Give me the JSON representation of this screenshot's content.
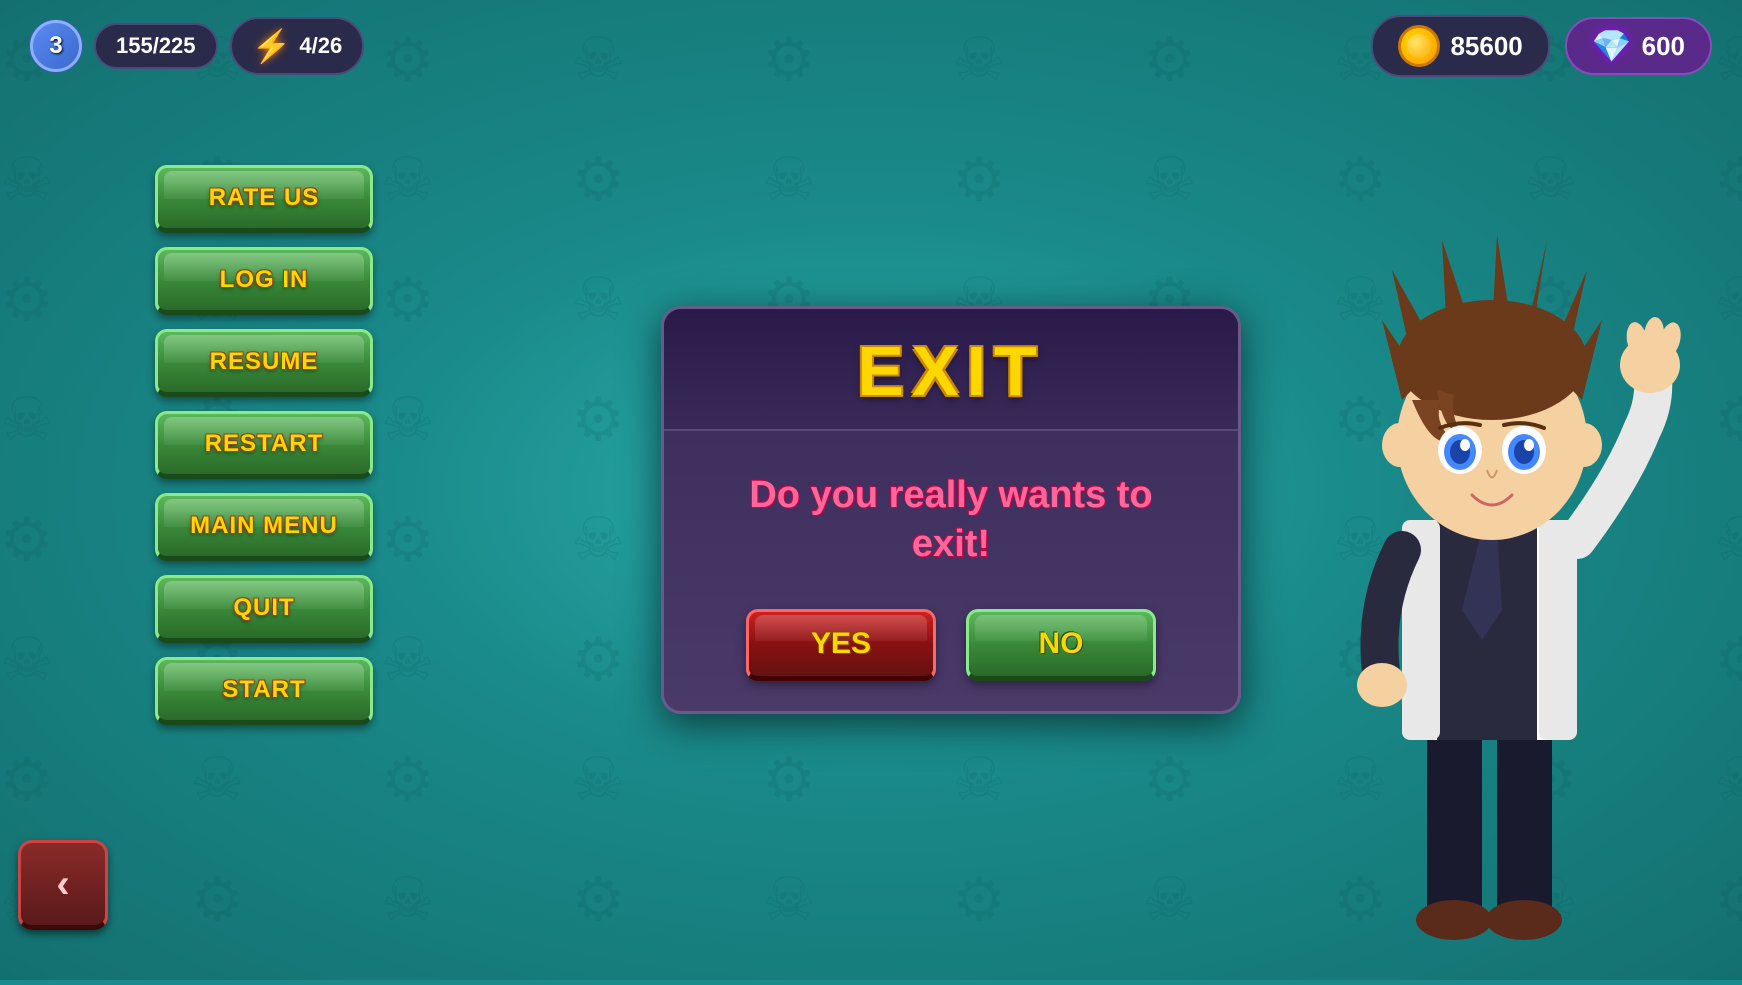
{
  "topbar": {
    "level": "3",
    "xp": "155/225",
    "energy": "4/26",
    "coins": "85600",
    "gems": "600"
  },
  "sidebar": {
    "buttons": [
      {
        "label": "RATE US",
        "id": "rate-us"
      },
      {
        "label": "LOG IN",
        "id": "log-in"
      },
      {
        "label": "RESUME",
        "id": "resume"
      },
      {
        "label": "RESTART",
        "id": "restart"
      },
      {
        "label": "MAIN MENU",
        "id": "main-menu"
      },
      {
        "label": "QUIT",
        "id": "quit"
      },
      {
        "label": "START",
        "id": "start"
      }
    ],
    "back_label": "<"
  },
  "dialog": {
    "title": "EXIT",
    "message": "Do you really wants to exit!",
    "yes_label": "YES",
    "no_label": "NO"
  }
}
